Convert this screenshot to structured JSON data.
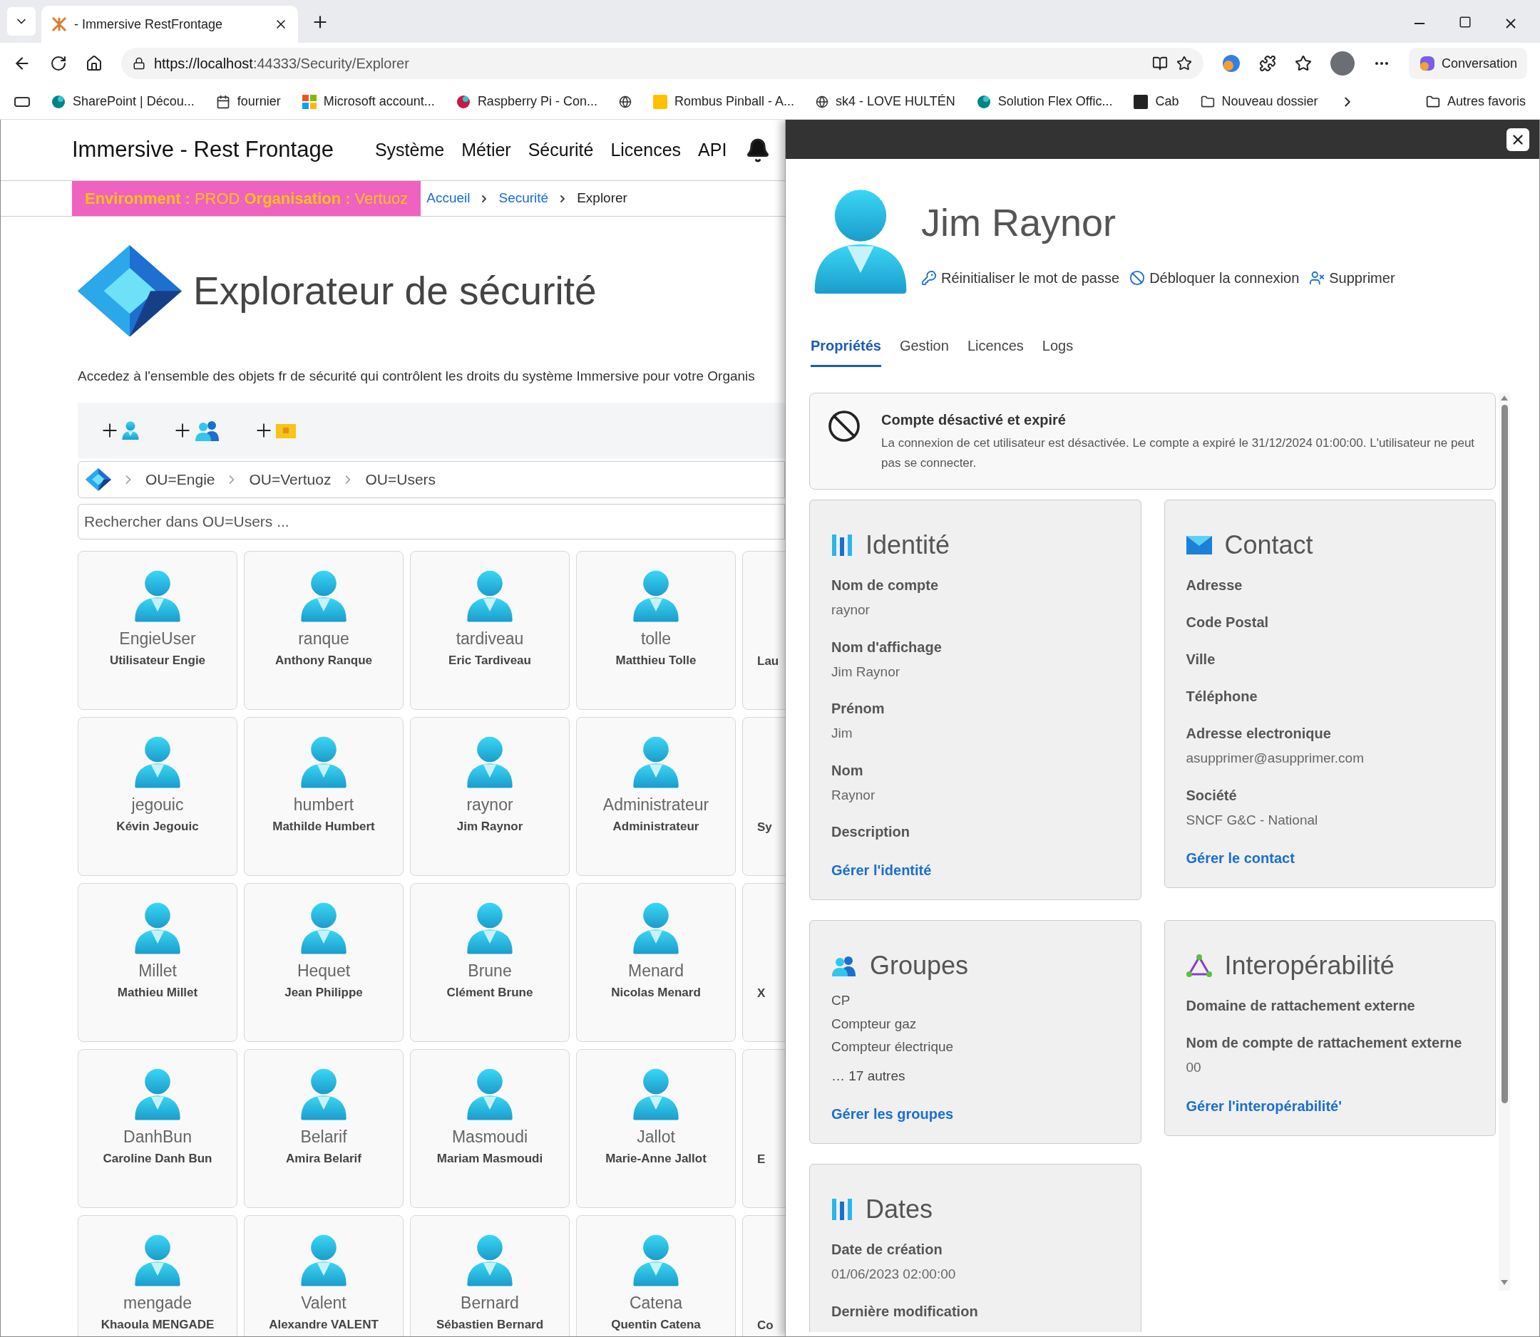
{
  "browser": {
    "tabs": [
      {
        "title": "- Immersive RestFrontage",
        "selected": true
      }
    ],
    "url_host": "https://localhost",
    "url_rest": ":44333/Security/Explorer",
    "copilot_label": "Conversation",
    "bookmarks": [
      {
        "kind": "site",
        "label": "SharePoint | Décou...",
        "color": "#038387"
      },
      {
        "kind": "calendar",
        "label": "fournier",
        "color": "#333333"
      },
      {
        "kind": "ms",
        "label": "Microsoft account...",
        "color": "#f25022"
      },
      {
        "kind": "site",
        "label": "Raspberry Pi - Con...",
        "color": "#c51a4a"
      },
      {
        "kind": "globe",
        "color": "#333333"
      },
      {
        "kind": "square",
        "label": "Rombus Pinball - A...",
        "color": "#ffc000"
      },
      {
        "kind": "globe",
        "label": "sk4 - LOVE HULTÉN",
        "color": "#333333"
      },
      {
        "kind": "site",
        "label": "Solution Flex Offic...",
        "color": "#038387"
      },
      {
        "kind": "square",
        "label": "Cab",
        "color": "#222222"
      },
      {
        "kind": "folder",
        "label": "Nouveau dossier",
        "color": "#333333"
      }
    ],
    "other_bookmarks": "Autres favoris"
  },
  "app": {
    "brand": "Immersive - Rest Frontage",
    "nav": [
      "Système",
      "Métier",
      "Sécurité",
      "Licences",
      "API"
    ],
    "env": [
      {
        "text": "Environment :",
        "bold": true
      },
      {
        "text": "PROD",
        "bold": false
      },
      {
        "text": "Organisation :",
        "bold": true
      },
      {
        "text": "Vertuoz",
        "bold": false
      }
    ],
    "breadcrumb": [
      {
        "label": "Accueil",
        "link": true
      },
      {
        "label": "Securité",
        "link": true
      },
      {
        "label": "Explorer",
        "link": false
      }
    ],
    "page_title": "Explorateur de sécurité",
    "description": "Accedez à l'ensemble des objets fr de sécurité qui contrôlent les droits du système Immersive pour votre Organis",
    "path": [
      "OU=Engie",
      "OU=Vertuoz",
      "OU=Users"
    ],
    "search": {
      "placeholder": "Rechercher dans OU=Users ..."
    },
    "users": [
      {
        "kind": "card",
        "login": "EngieUser",
        "name": "Utilisateur Engie"
      },
      {
        "kind": "card",
        "login": "ranque",
        "name": "Anthony Ranque"
      },
      {
        "kind": "card",
        "login": "tardiveau",
        "name": "Eric Tardiveau"
      },
      {
        "kind": "card",
        "login": "tolle",
        "name": "Matthieu Tolle"
      },
      {
        "kind": "partial",
        "name": "Lau"
      },
      {
        "kind": "card",
        "login": "jegouic",
        "name": "Kévin Jegouic"
      },
      {
        "kind": "card",
        "login": "humbert",
        "name": "Mathilde Humbert"
      },
      {
        "kind": "card",
        "login": "raynor",
        "name": "Jim Raynor"
      },
      {
        "kind": "card",
        "login": "Administrateur",
        "name": "Administrateur"
      },
      {
        "kind": "partial",
        "name": "Sy"
      },
      {
        "kind": "card",
        "login": "Millet",
        "name": "Mathieu Millet"
      },
      {
        "kind": "card",
        "login": "Hequet",
        "name": "Jean Philippe"
      },
      {
        "kind": "card",
        "login": "Brune",
        "name": "Clément Brune"
      },
      {
        "kind": "card",
        "login": "Menard",
        "name": "Nicolas Menard"
      },
      {
        "kind": "partial",
        "name": "X"
      },
      {
        "kind": "card",
        "login": "DanhBun",
        "name": "Caroline Danh Bun"
      },
      {
        "kind": "card",
        "login": "Belarif",
        "name": "Amira Belarif"
      },
      {
        "kind": "card",
        "login": "Masmoudi",
        "name": "Mariam Masmoudi"
      },
      {
        "kind": "card",
        "login": "Jallot",
        "name": "Marie-Anne Jallot"
      },
      {
        "kind": "partial",
        "name": "E"
      },
      {
        "kind": "card",
        "login": "mengade",
        "name": "Khaoula MENGADE"
      },
      {
        "kind": "card",
        "login": "Valent",
        "name": "Alexandre VALENT"
      },
      {
        "kind": "card",
        "login": "Bernard",
        "name": "Sébastien Bernard"
      },
      {
        "kind": "card",
        "login": "Catena",
        "name": "Quentin Catena"
      },
      {
        "kind": "partial",
        "name": "Co"
      }
    ]
  },
  "panel": {
    "user_name": "Jim Raynor",
    "actions": [
      {
        "kind": "key",
        "label": "Réinitialiser le mot de passe"
      },
      {
        "kind": "unblock",
        "label": "Débloquer la connexion"
      },
      {
        "kind": "delete",
        "label": "Supprimer"
      }
    ],
    "tabs": [
      {
        "label": "Propriétés",
        "selected": true
      },
      {
        "label": "Gestion",
        "selected": false
      },
      {
        "label": "Licences",
        "selected": false
      },
      {
        "label": "Logs",
        "selected": false
      }
    ],
    "alert": {
      "title": "Compte désactivé et expiré",
      "text": "La connexion de cet utilisateur est désactivée. Le compte a expiré le 31/12/2024 01:00:00. L'utilisateur ne peut pas se connecter."
    },
    "sections": [
      {
        "kind": "bars",
        "title": "Identité",
        "fields": [
          {
            "label": "Nom de compte",
            "value": "raynor"
          },
          {
            "label": "Nom d'affichage",
            "value": "Jim Raynor"
          },
          {
            "label": "Prénom",
            "value": "Jim"
          },
          {
            "label": "Nom",
            "value": "Raynor"
          },
          {
            "label": "Description"
          }
        ],
        "link": "Gérer l'identité"
      },
      {
        "kind": "mail",
        "title": "Contact",
        "fields": [
          {
            "label": "Adresse"
          },
          {
            "label": "Code Postal"
          },
          {
            "label": "Ville"
          },
          {
            "label": "Téléphone"
          },
          {
            "label": "Adresse electronique",
            "value": "asupprimer@asupprimer.com"
          },
          {
            "label": "Société",
            "value": "SNCF G&C - National"
          }
        ],
        "link": "Gérer le contact"
      },
      {
        "kind": "people",
        "title": "Groupes",
        "items": [
          "CP",
          "Compteur gaz",
          "Compteur électrique"
        ],
        "more": "… 17 autres",
        "link": "Gérer les groupes"
      },
      {
        "kind": "triangle",
        "title": "Interopérabilité",
        "fields": [
          {
            "label": "Domaine de rattachement externe"
          },
          {
            "label": "Nom de compte de rattachement externe",
            "value": "00"
          }
        ],
        "link": "Gérer l'interopérabilité'"
      },
      {
        "kind": "bars",
        "title": "Dates",
        "fields": [
          {
            "label": "Date de création",
            "value": "01/06/2023 02:00:00"
          },
          {
            "label": "Dernière modification"
          }
        ]
      }
    ]
  }
}
